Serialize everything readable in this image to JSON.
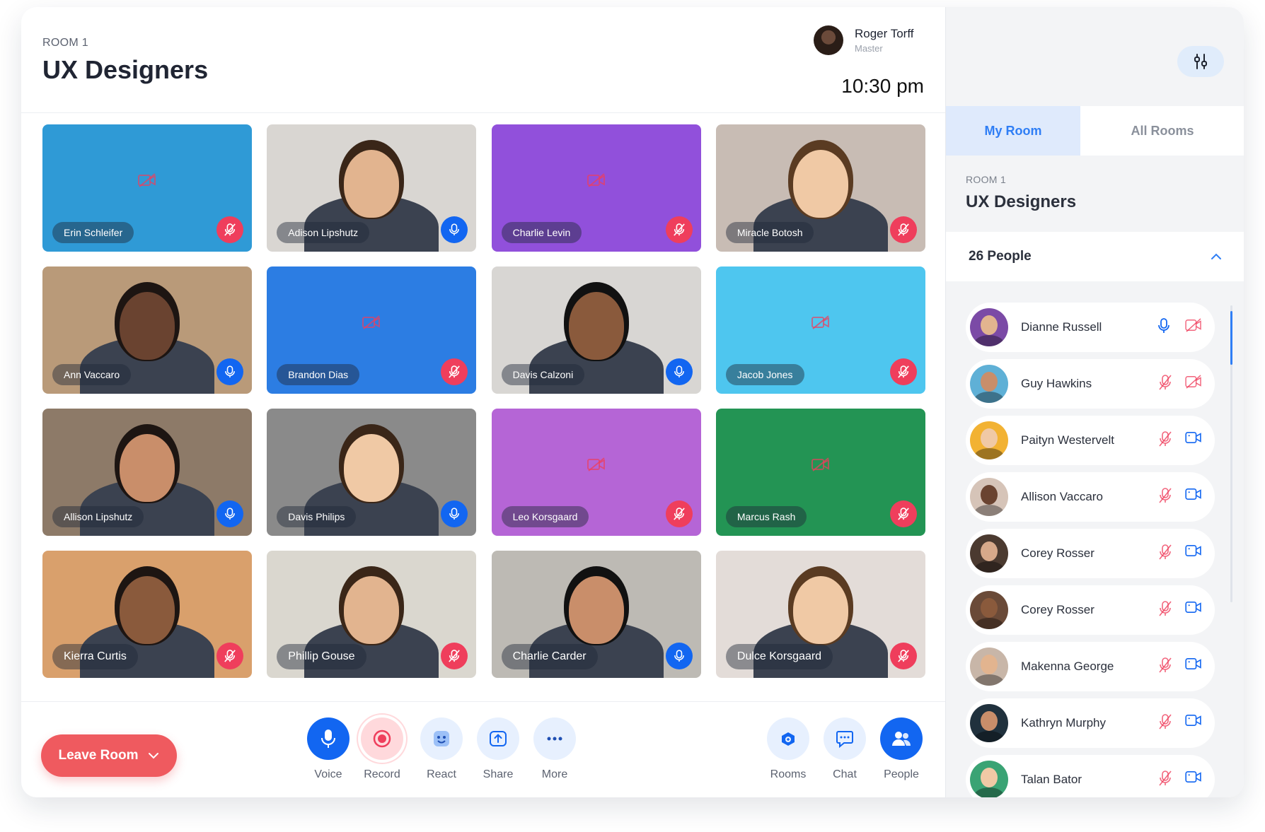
{
  "header": {
    "room_label": "ROOM 1",
    "room_title": "UX Designers",
    "host_name": "Roger Torff",
    "host_role": "Master",
    "time": "10:30 pm"
  },
  "tiles": [
    {
      "name": "Erin Schleifer",
      "mic": "off",
      "video": "off",
      "bg": "#2f9ad6"
    },
    {
      "name": "Adison Lipshutz",
      "mic": "on",
      "video": "on",
      "bg": "#d9d6d2"
    },
    {
      "name": "Charlie Levin",
      "mic": "off",
      "video": "off",
      "bg": "#9150db"
    },
    {
      "name": "Miracle Botosh",
      "mic": "off",
      "video": "on",
      "bg": "#c8bcb4"
    },
    {
      "name": "Ann Vaccaro",
      "mic": "on",
      "video": "on",
      "bg": "#b99a79"
    },
    {
      "name": "Brandon Dias",
      "mic": "off",
      "video": "off",
      "bg": "#2c7de3"
    },
    {
      "name": "Davis Calzoni",
      "mic": "on",
      "video": "on",
      "bg": "#d8d6d3"
    },
    {
      "name": "Jacob Jones",
      "mic": "off",
      "video": "off",
      "bg": "#4ec6ef"
    },
    {
      "name": "Allison Lipshutz",
      "mic": "on",
      "video": "on",
      "bg": "#8d7a68"
    },
    {
      "name": "Davis Philips",
      "mic": "on",
      "video": "on",
      "bg": "#8a8a8a"
    },
    {
      "name": "Leo Korsgaard",
      "mic": "off",
      "video": "off",
      "bg": "#b565d6"
    },
    {
      "name": "Marcus Rash",
      "mic": "off",
      "video": "off",
      "bg": "#239454"
    },
    {
      "name": "Kierra Curtis",
      "mic": "off",
      "video": "on",
      "bg": "#d9a06c"
    },
    {
      "name": "Phillip Gouse",
      "mic": "off",
      "video": "on",
      "bg": "#dad7cf"
    },
    {
      "name": "Charlie Carder",
      "mic": "on",
      "video": "on",
      "bg": "#bdbab4"
    },
    {
      "name": "Dulce Korsgaard",
      "mic": "off",
      "video": "on",
      "bg": "#e3dcd8"
    }
  ],
  "footer": {
    "leave_label": "Leave Room",
    "controls": [
      {
        "label": "Voice",
        "icon": "mic-icon"
      },
      {
        "label": "Record",
        "icon": "record-icon"
      },
      {
        "label": "React",
        "icon": "react-icon"
      },
      {
        "label": "Share",
        "icon": "share-icon"
      },
      {
        "label": "More",
        "icon": "more-icon"
      }
    ],
    "right_controls": [
      {
        "label": "Rooms",
        "icon": "rooms-icon"
      },
      {
        "label": "Chat",
        "icon": "chat-icon"
      },
      {
        "label": "People",
        "icon": "people-icon"
      }
    ]
  },
  "sidebar": {
    "tabs": [
      "My Room",
      "All Rooms"
    ],
    "room_label": "ROOM 1",
    "room_title": "UX Designers",
    "people_count": "26 People",
    "people": [
      {
        "name": "Dianne Russell",
        "mic": "on",
        "video": "off"
      },
      {
        "name": "Guy Hawkins",
        "mic": "off",
        "video": "off"
      },
      {
        "name": "Paityn Westervelt",
        "mic": "off",
        "video": "on"
      },
      {
        "name": "Allison Vaccaro",
        "mic": "off",
        "video": "on"
      },
      {
        "name": "Corey Rosser",
        "mic": "off",
        "video": "on"
      },
      {
        "name": "Corey Rosser",
        "mic": "off",
        "video": "on"
      },
      {
        "name": "Makenna George",
        "mic": "off",
        "video": "on"
      },
      {
        "name": "Kathryn Murphy",
        "mic": "off",
        "video": "on"
      },
      {
        "name": "Talan Bator",
        "mic": "off",
        "video": "on"
      }
    ]
  },
  "colors": {
    "accent": "#1266f1",
    "danger": "#ef3e5c",
    "leave": "#ef5a5f",
    "tab_active": "#2f7ef5"
  }
}
